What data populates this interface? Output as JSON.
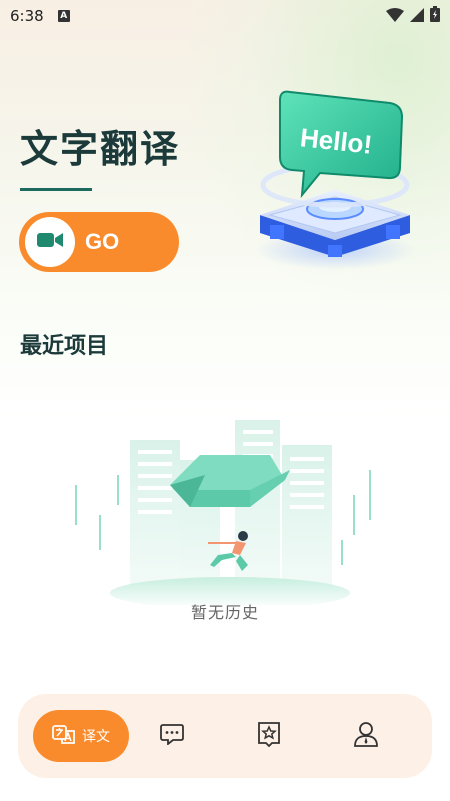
{
  "status_bar": {
    "time": "6:38",
    "notification_letter": "A",
    "icons": [
      "wifi-icon",
      "cell-signal-icon",
      "battery-icon"
    ]
  },
  "header": {
    "title": "文字翻译",
    "go_button_label": "GO",
    "go_icon": "video-camera-icon",
    "hero_bubble_text": "Hello!"
  },
  "recent": {
    "section_title": "最近项目",
    "empty_text": "暂无历史"
  },
  "bottom_nav": {
    "items": [
      {
        "icon": "translate-icon",
        "label": "译文",
        "active": true
      },
      {
        "icon": "chat-icon",
        "label": "",
        "active": false
      },
      {
        "icon": "favorites-icon",
        "label": "",
        "active": false
      },
      {
        "icon": "profile-icon",
        "label": "",
        "active": false
      }
    ]
  },
  "colors": {
    "accent": "#f98b2c",
    "title": "#1c3a3a",
    "underline": "#1d6b5e",
    "nav_bg": "#fdf0e6"
  }
}
